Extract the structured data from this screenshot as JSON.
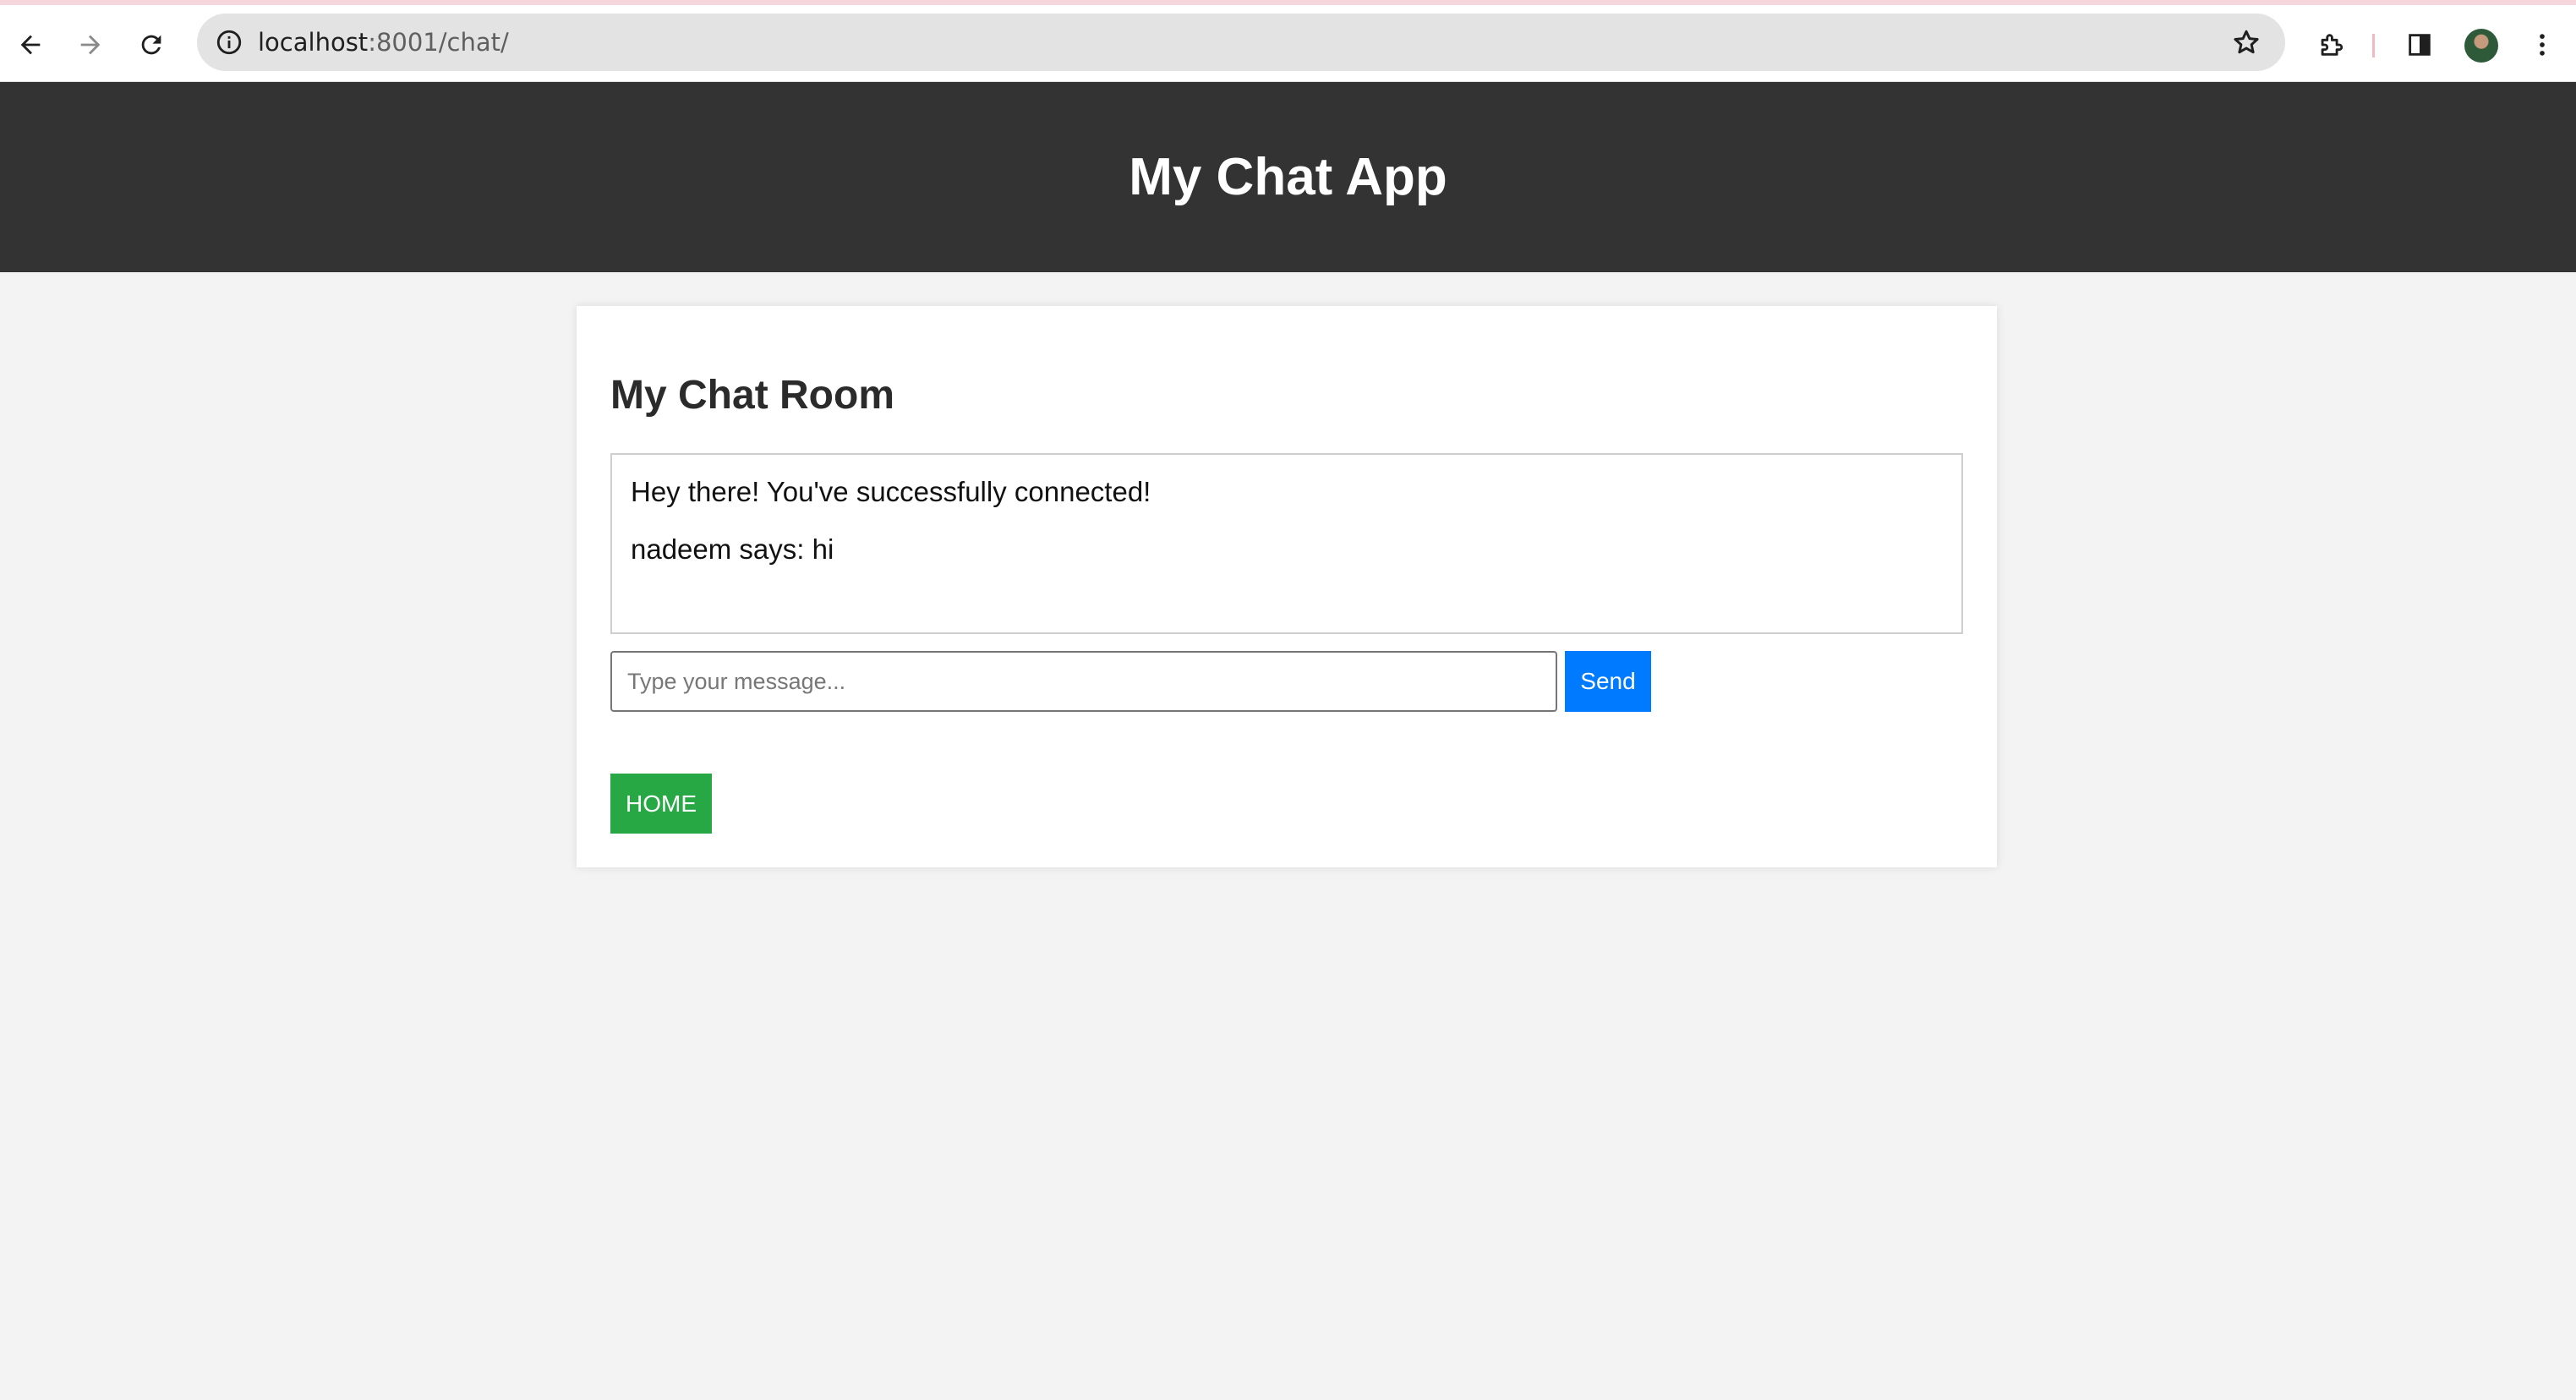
{
  "browser": {
    "url_host": "localhost",
    "url_rest": ":8001/chat/",
    "icons": [
      "back-arrow-icon",
      "forward-arrow-icon",
      "reload-icon",
      "site-info-icon",
      "bookmark-star-icon",
      "extensions-icon",
      "side-panel-icon",
      "profile-avatar",
      "kebab-menu-icon"
    ]
  },
  "header": {
    "title": "My Chat App"
  },
  "chat": {
    "room_title": "My Chat Room",
    "messages": [
      {
        "text": "Hey there! You've successfully connected!"
      },
      {
        "text": "nadeem says: hi"
      }
    ],
    "input_placeholder": "Type your message...",
    "send_label": "Send",
    "home_label": "HOME"
  },
  "colors": {
    "header_bg": "#333333",
    "page_bg": "#f3f3f3",
    "send_button": "#007bff",
    "home_button": "#28a745"
  }
}
